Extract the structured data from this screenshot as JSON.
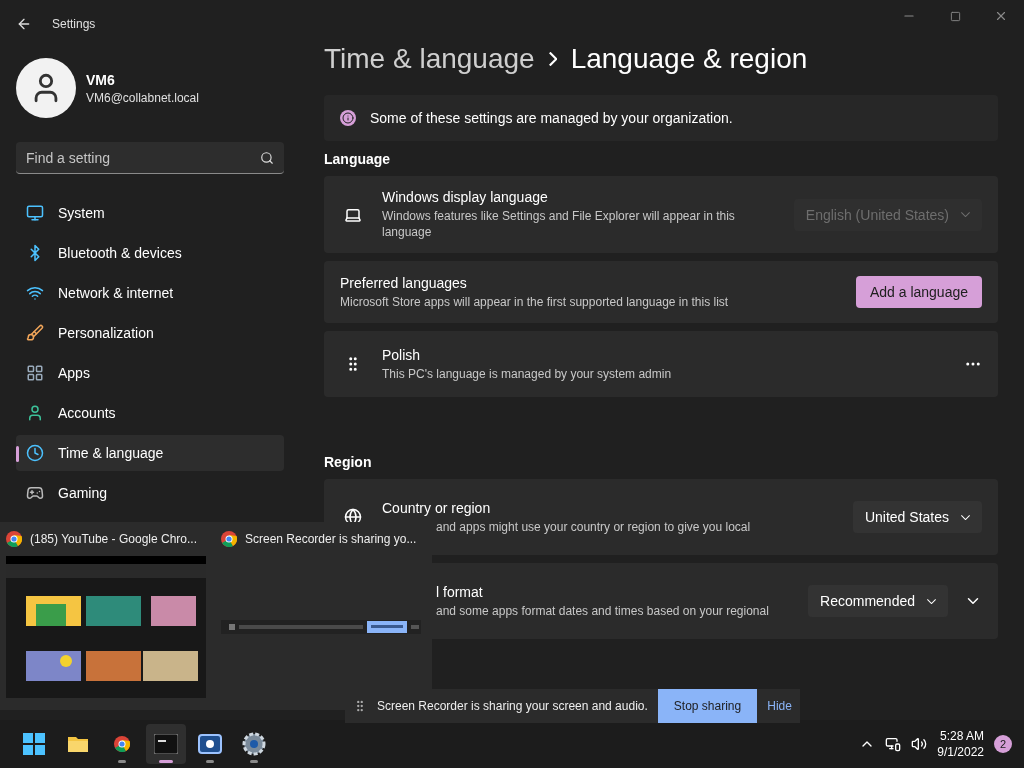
{
  "window": {
    "title": "Settings"
  },
  "user": {
    "name": "VM6",
    "email": "VM6@collabnet.local"
  },
  "search": {
    "placeholder": "Find a setting"
  },
  "sidebar": {
    "items": [
      {
        "label": "System",
        "selected": false
      },
      {
        "label": "Bluetooth & devices",
        "selected": false
      },
      {
        "label": "Network & internet",
        "selected": false
      },
      {
        "label": "Personalization",
        "selected": false
      },
      {
        "label": "Apps",
        "selected": false
      },
      {
        "label": "Accounts",
        "selected": false
      },
      {
        "label": "Time & language",
        "selected": true
      },
      {
        "label": "Gaming",
        "selected": false
      }
    ]
  },
  "breadcrumb": {
    "parent": "Time & language",
    "current": "Language & region"
  },
  "notice": "Some of these settings are managed by your organization.",
  "sections": [
    {
      "heading": "Language",
      "rows": [
        {
          "kind": "dropdown",
          "title": "Windows display language",
          "subtitle": "Windows features like Settings and File Explorer will appear in this language",
          "value": "English (United States)",
          "disabled": true
        },
        {
          "kind": "button",
          "title": "Preferred languages",
          "subtitle": "Microsoft Store apps will appear in the first supported language in this list",
          "button": "Add a language"
        },
        {
          "kind": "language",
          "title": "Polish",
          "subtitle": "This PC's language is managed by your system admin"
        }
      ]
    },
    {
      "heading": "Region",
      "rows": [
        {
          "kind": "dropdown",
          "title": "Country or region",
          "subtitle": "and apps might use your country or region to give you local",
          "value": "United States",
          "disabled": false
        },
        {
          "kind": "dropdown",
          "title": "l format",
          "subtitle": "and some apps format dates and times based on your regional",
          "value": "Recommended",
          "disabled": false,
          "expanded": false
        }
      ]
    }
  ],
  "taskbar_preview": {
    "windows": [
      {
        "title": "(185) YouTube - Google Chro...",
        "kind": "picture"
      },
      {
        "title": "Screen Recorder is sharing yo...",
        "kind": "picture"
      }
    ]
  },
  "share_bar": {
    "text": "Screen Recorder is sharing your screen and audio.",
    "stop": "Stop sharing",
    "hide": "Hide"
  },
  "taskbar": {
    "apps": [
      {
        "running": false,
        "selected": false
      },
      {
        "running": true,
        "selected": false
      },
      {
        "running": true,
        "selected": true
      },
      {
        "running": true,
        "selected": false
      },
      {
        "running": true,
        "selected": false
      }
    ]
  },
  "tray": {
    "time": "5:28 AM",
    "date": "9/1/2022",
    "badge": "2"
  }
}
